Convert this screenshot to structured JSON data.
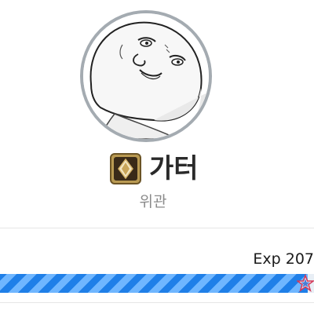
{
  "profile": {
    "name": "가터",
    "title": "위관",
    "avatar_icon": "cartoon-face-avatar",
    "rank_icon": "gold-diamond-rank-badge"
  },
  "experience": {
    "label": "Exp 207",
    "progress_fraction": 0.98,
    "bar_colors": [
      "#1f7fe8",
      "#6fb6ff"
    ]
  },
  "colors": {
    "avatar_border": "#a4abb1",
    "badge_gold": "#b99a52",
    "badge_dark": "#3a2a18"
  }
}
